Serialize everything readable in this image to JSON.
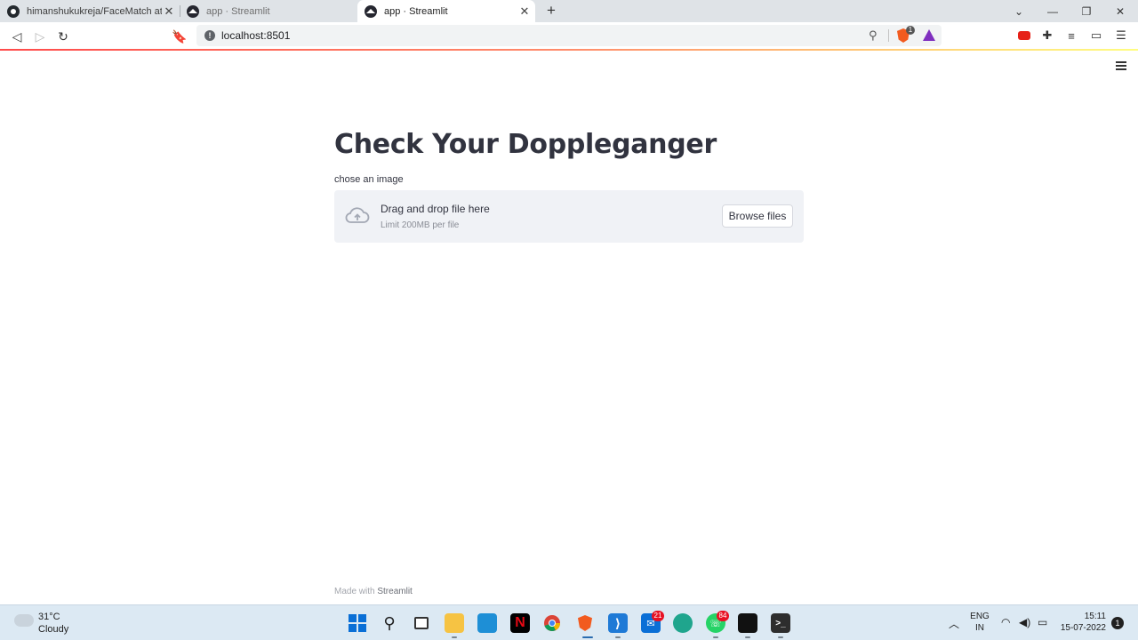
{
  "browser": {
    "tabs": [
      {
        "title": "himanshukukreja/FaceMatch at mai",
        "active": false
      },
      {
        "title": "app · Streamlit",
        "active": false
      },
      {
        "title": "app · Streamlit",
        "active": true
      }
    ],
    "address": "localhost:8501",
    "shield_badge": "1",
    "new_tab_label": "+"
  },
  "app": {
    "title": "Check Your Doppleganger",
    "uploader": {
      "label": "chose an image",
      "drop_text": "Drag and drop file here",
      "limit_text": "Limit 200MB per file",
      "browse_label": "Browse files"
    },
    "footer": {
      "prefix": "Made with",
      "brand": "Streamlit"
    },
    "accent_color": "#ff4b4b"
  },
  "taskbar": {
    "weather": {
      "temp": "31°C",
      "desc": "Cloudy"
    },
    "apps": [
      {
        "name": "start-icon"
      },
      {
        "name": "search-icon"
      },
      {
        "name": "task-view-icon"
      },
      {
        "name": "file-explorer-icon"
      },
      {
        "name": "monitor-icon"
      },
      {
        "name": "netflix-icon"
      },
      {
        "name": "chrome-icon"
      },
      {
        "name": "brave-icon"
      },
      {
        "name": "vscode-icon"
      },
      {
        "name": "mail-icon",
        "badge": "21"
      },
      {
        "name": "edge-icon"
      },
      {
        "name": "whatsapp-icon",
        "badge": "84"
      },
      {
        "name": "terminal-icon"
      },
      {
        "name": "console-icon"
      }
    ],
    "lang_line1": "ENG",
    "lang_line2": "IN",
    "time": "15:11",
    "date": "15-07-2022",
    "notification_count": "1"
  }
}
